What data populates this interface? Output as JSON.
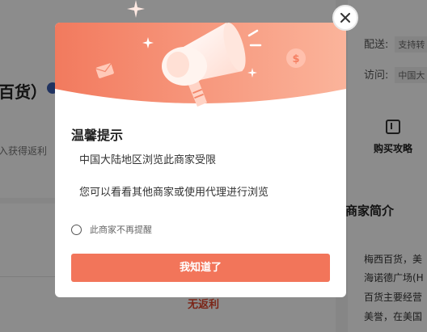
{
  "background": {
    "store_name": "百货）",
    "rebate_hint": "入获得返利",
    "no_rebate": "无返利",
    "shipping_label": "配送:",
    "shipping_value": "支持转",
    "visit_label": "访问:",
    "visit_value": "中国大",
    "buy_guide_label": "购买攻略",
    "intro_title": "商家简介",
    "intro_lines": [
      "梅西百货，美",
      "海诺德广场(H",
      "百货主要经营",
      "美誉，在美国"
    ]
  },
  "dialog": {
    "title": "温馨提示",
    "message_1": "中国大陆地区浏览此商家受限",
    "message_2": "您可以看看其他商家或使用代理进行浏览",
    "dont_remind_label": "此商家不再提醒",
    "ok_label": "我知道了",
    "close_icon": "close-icon",
    "banner_icons": [
      "megaphone-icon",
      "coin-icon",
      "envelope-icon",
      "sparkle-icon"
    ]
  },
  "colors": {
    "accent": "#f2755a",
    "banner_start": "#f27a5e",
    "banner_end": "#fbb49b",
    "warning_text": "#e0462d"
  }
}
